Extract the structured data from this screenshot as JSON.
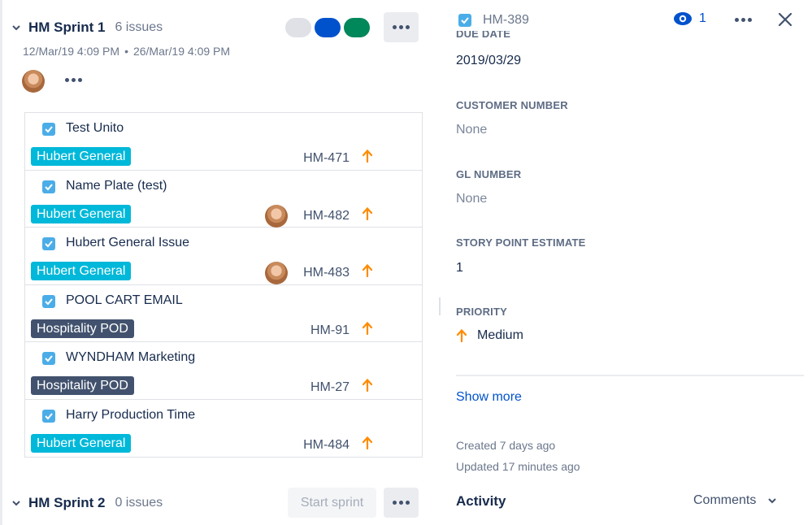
{
  "sprint1": {
    "name": "HM Sprint 1",
    "count": "6 issues",
    "start": "12/Mar/19 4:09 PM",
    "separator": "•",
    "end": "26/Mar/19 4:09 PM",
    "pill_colors": [
      "#DFE1E6",
      "#0052CC",
      "#00875A"
    ]
  },
  "issues": [
    {
      "title": "Test Unito",
      "label": "Hubert General",
      "label_color": "#00B8D9",
      "key": "HM-471",
      "assignee": false
    },
    {
      "title": "Name Plate (test)",
      "label": "Hubert General",
      "label_color": "#00B8D9",
      "key": "HM-482",
      "assignee": true
    },
    {
      "title": "Hubert General Issue",
      "label": "Hubert General",
      "label_color": "#00B8D9",
      "key": "HM-483",
      "assignee": true
    },
    {
      "title": "POOL CART EMAIL",
      "label": "Hospitality POD",
      "label_color": "#42526E",
      "key": "HM-91",
      "assignee": false
    },
    {
      "title": "WYNDHAM Marketing",
      "label": "Hospitality POD",
      "label_color": "#42526E",
      "key": "HM-27",
      "assignee": false
    },
    {
      "title": "Harry Production Time",
      "label": "Hubert General",
      "label_color": "#00B8D9",
      "key": "HM-484",
      "assignee": false
    }
  ],
  "sprint2": {
    "name": "HM Sprint 2",
    "count": "0 issues",
    "start_label": "Start sprint"
  },
  "detail": {
    "key": "HM-389",
    "watchers": "1",
    "due_date_label": "DUE DATE",
    "due_date": "2019/03/29",
    "customer_number_label": "CUSTOMER NUMBER",
    "customer_number": "None",
    "gl_number_label": "GL NUMBER",
    "gl_number": "None",
    "story_points_label": "STORY POINT ESTIMATE",
    "story_points": "1",
    "priority_label": "PRIORITY",
    "priority": "Medium",
    "show_more": "Show more",
    "created": "Created 7 days ago",
    "updated": "Updated 17 minutes ago",
    "activity": "Activity",
    "comments": "Comments"
  },
  "colors": {
    "accent": "#0052CC",
    "priority_medium": "#FF8B00",
    "checkbox": "#4BADE8"
  }
}
